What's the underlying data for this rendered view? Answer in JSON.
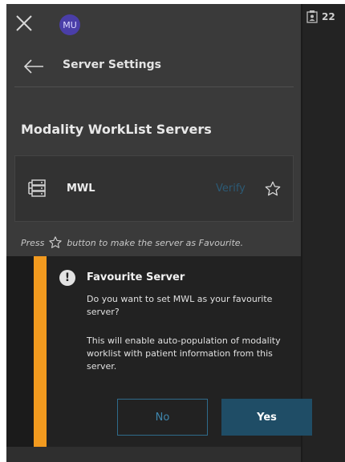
{
  "app": {
    "avatar_initials": "MU",
    "badge_count": "22"
  },
  "header": {
    "title": "Server Settings"
  },
  "section": {
    "title": "Modality WorkList Servers"
  },
  "server": {
    "name": "MWL",
    "verify_label": "Verify"
  },
  "hint": {
    "prefix": "Press",
    "suffix": "button to make the server as Favourite."
  },
  "dialog": {
    "title": "Favourite Server",
    "question": "Do you want to set MWL as your favourite server?",
    "info": "This will enable auto-population of modality worklist with patient information from this server.",
    "no_label": "No",
    "yes_label": "Yes"
  },
  "colors": {
    "accent": "#f29a1f",
    "primary_button": "#1f4d66",
    "secondary_button_text": "#3f86ad",
    "verify_disabled": "#2c5a75",
    "avatar": "#4a3ea8"
  },
  "icons": {
    "close": "close-icon",
    "back": "back-arrow-icon",
    "server": "server-icon",
    "star": "star-outline-icon",
    "warning": "warning-icon",
    "clipboard": "clipboard-user-icon"
  }
}
